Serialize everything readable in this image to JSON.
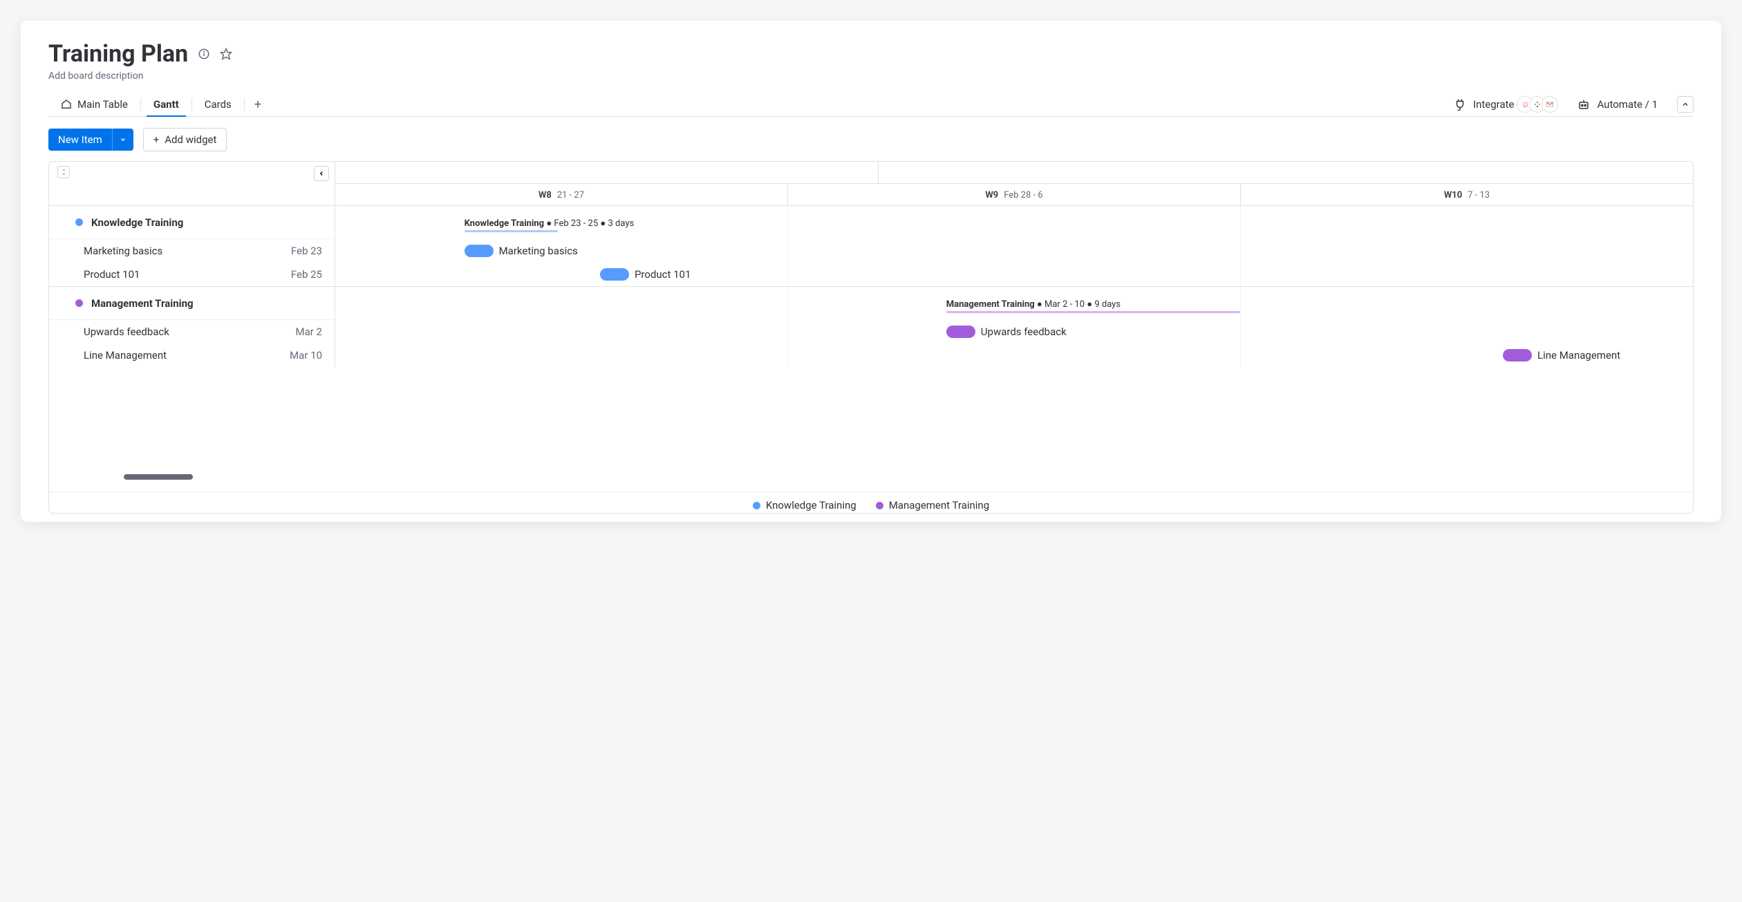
{
  "colors": {
    "blue": "#579bfc",
    "purple": "#a25ddc"
  },
  "title": "Training Plan",
  "subtitle": "Add board description",
  "tabs": {
    "main": "Main Table",
    "gantt": "Gantt",
    "cards": "Cards"
  },
  "integrate_label": "Integrate",
  "automate_label": "Automate / 1",
  "new_item_label": "New Item",
  "add_widget_label": "Add widget",
  "weeks": [
    {
      "w": "W8",
      "range": "21 - 27"
    },
    {
      "w": "W9",
      "range": "Feb 28 - 6"
    },
    {
      "w": "W10",
      "range": "7 - 13"
    }
  ],
  "groups": [
    {
      "name": "Knowledge Training",
      "color": "#579bfc",
      "summary_name": "Knowledge Training",
      "summary_range": "Feb 23 - 25",
      "summary_days": "3 days",
      "tasks": [
        {
          "name": "Marketing basics",
          "date": "Feb 23"
        },
        {
          "name": "Product 101",
          "date": "Feb 25"
        }
      ]
    },
    {
      "name": "Management Training",
      "color": "#a25ddc",
      "summary_name": "Management Training",
      "summary_range": "Mar 2 - 10",
      "summary_days": "9 days",
      "tasks": [
        {
          "name": "Upwards feedback",
          "date": "Mar 2"
        },
        {
          "name": "Line Management",
          "date": "Mar 10"
        }
      ]
    }
  ],
  "legend": [
    {
      "text": "Knowledge Training",
      "color": "#579bfc"
    },
    {
      "text": "Management Training",
      "color": "#a25ddc"
    }
  ]
}
